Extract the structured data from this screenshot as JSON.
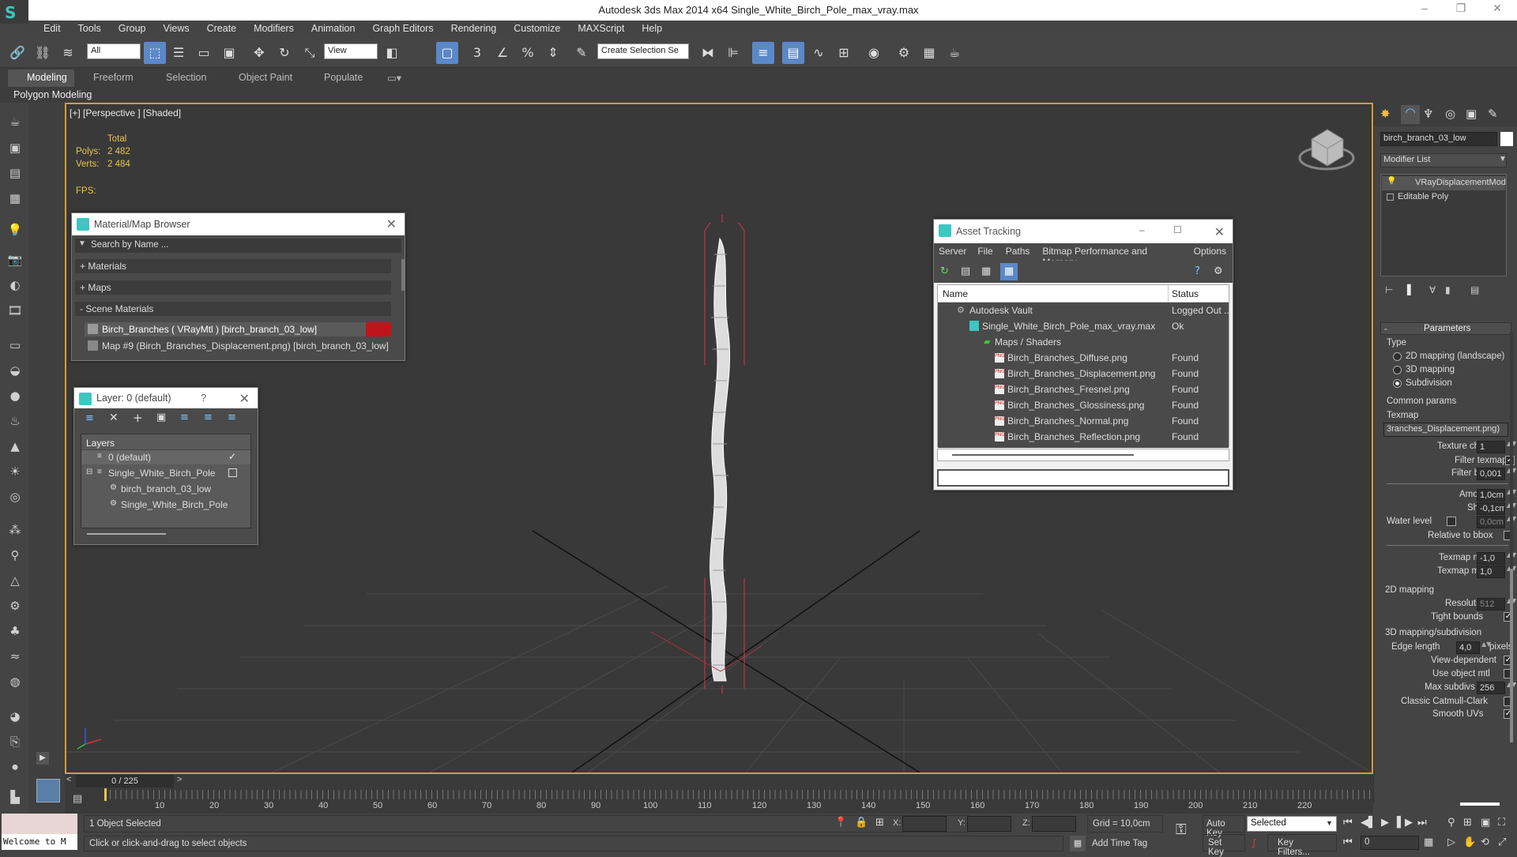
{
  "app": {
    "title": "Autodesk 3ds Max  2014 x64     Single_White_Birch_Pole_max_vray.max"
  },
  "menu": [
    "Edit",
    "Tools",
    "Group",
    "Views",
    "Create",
    "Modifiers",
    "Animation",
    "Graph Editors",
    "Rendering",
    "Customize",
    "MAXScript",
    "Help"
  ],
  "toolbar": {
    "selection_filter": "All",
    "ref_coord": "View",
    "named_selection": "Create Selection Se"
  },
  "ribbon": {
    "tabs": [
      "Modeling",
      "Freeform",
      "Selection",
      "Object Paint",
      "Populate"
    ],
    "active": "Modeling",
    "sub": "Polygon Modeling"
  },
  "viewport": {
    "label": "[+] [Perspective ] [Shaded]",
    "stats": {
      "total_label": "Total",
      "polys_label": "Polys:",
      "polys": "2 482",
      "verts_label": "Verts:",
      "verts": "2 484",
      "fps_label": "FPS:"
    }
  },
  "material_browser": {
    "title": "Material/Map Browser",
    "search_placeholder": "Search by Name ...",
    "groups": [
      "+ Materials",
      "+ Maps",
      "- Scene Materials"
    ],
    "items": [
      "Birch_Branches  ( VRayMtl ) [birch_branch_03_low]",
      "Map #9 (Birch_Branches_Displacement.png) [birch_branch_03_low]"
    ]
  },
  "layer_window": {
    "title": "Layer: 0 (default)",
    "help": "?",
    "header": "Layers",
    "rows": [
      "0 (default)",
      "Single_White_Birch_Pole",
      "birch_branch_03_low",
      "Single_White_Birch_Pole"
    ]
  },
  "asset_tracking": {
    "title": "Asset Tracking",
    "menu": [
      "Server",
      "File",
      "Paths",
      "Bitmap Performance and Memory",
      "Options"
    ],
    "columns": [
      "Name",
      "Status"
    ],
    "rows": [
      {
        "name": "Autodesk Vault",
        "status": "Logged Out ..."
      },
      {
        "name": "Single_White_Birch_Pole_max_vray.max",
        "status": "Ok"
      },
      {
        "name": "Maps / Shaders",
        "status": ""
      },
      {
        "name": "Birch_Branches_Diffuse.png",
        "status": "Found"
      },
      {
        "name": "Birch_Branches_Displacement.png",
        "status": "Found"
      },
      {
        "name": "Birch_Branches_Fresnel.png",
        "status": "Found"
      },
      {
        "name": "Birch_Branches_Glossiness.png",
        "status": "Found"
      },
      {
        "name": "Birch_Branches_Normal.png",
        "status": "Found"
      },
      {
        "name": "Birch_Branches_Reflection.png",
        "status": "Found"
      }
    ]
  },
  "command_panel": {
    "object_name": "birch_branch_03_low",
    "modifier_list": "Modifier List",
    "stack": [
      "VRayDisplacementMod",
      "Editable Poly"
    ],
    "rollout": "Parameters",
    "type_label": "Type",
    "types": [
      "2D mapping (landscape)",
      "3D mapping",
      "Subdivision"
    ],
    "common_label": "Common params",
    "texmap_label": "Texmap",
    "texmap": "3ranches_Displacement.png)",
    "texture_chan_label": "Texture chan",
    "texture_chan": "1",
    "filter_texmap_label": "Filter texmap",
    "filter_blur_label": "Filter blur",
    "filter_blur": "0,001",
    "amount_label": "Amount",
    "amount": "1,0cm",
    "shift_label": "Shift",
    "shift": "-0,1cm",
    "water_label": "Water level",
    "water": "0,0cm",
    "relative_label": "Relative to bbox",
    "texmap_min_label": "Texmap min",
    "texmap_min": "-1,0",
    "texmap_max_label": "Texmap max",
    "texmap_max": "1,0",
    "mapping2d_label": "2D mapping",
    "resolution_label": "Resolution",
    "resolution": "512",
    "tight_label": "Tight bounds",
    "mapping3d_label": "3D mapping/subdivision",
    "edge_label": "Edge length",
    "edge": "4,0",
    "pixels_label": "pixels",
    "view_dep_label": "View-dependent",
    "use_obj_label": "Use object mtl",
    "max_subdivs_label": "Max subdivs",
    "max_subdivs": "256",
    "catmull_label": "Classic Catmull-Clark",
    "smooth_uvs_label": "Smooth UVs"
  },
  "timeline": {
    "frame": "0 / 225",
    "ticks": [
      "10",
      "20",
      "30",
      "40",
      "50",
      "60",
      "70",
      "80",
      "90",
      "100",
      "110",
      "120",
      "130",
      "140",
      "150",
      "160",
      "170",
      "180",
      "190",
      "200",
      "210",
      "220"
    ]
  },
  "status": {
    "script": "Welcome to M",
    "selected": "1 Object Selected",
    "hint": "Click or click-and-drag to select objects",
    "x": "X:",
    "y": "Y:",
    "z": "Z:",
    "grid": "Grid = 10,0cm",
    "auto_key": "Auto Key",
    "set_key": "Set Key",
    "key_mode": "Selected",
    "key_filters": "Key Filters...",
    "add_time_tag": "Add Time Tag",
    "frame_value": "0"
  }
}
